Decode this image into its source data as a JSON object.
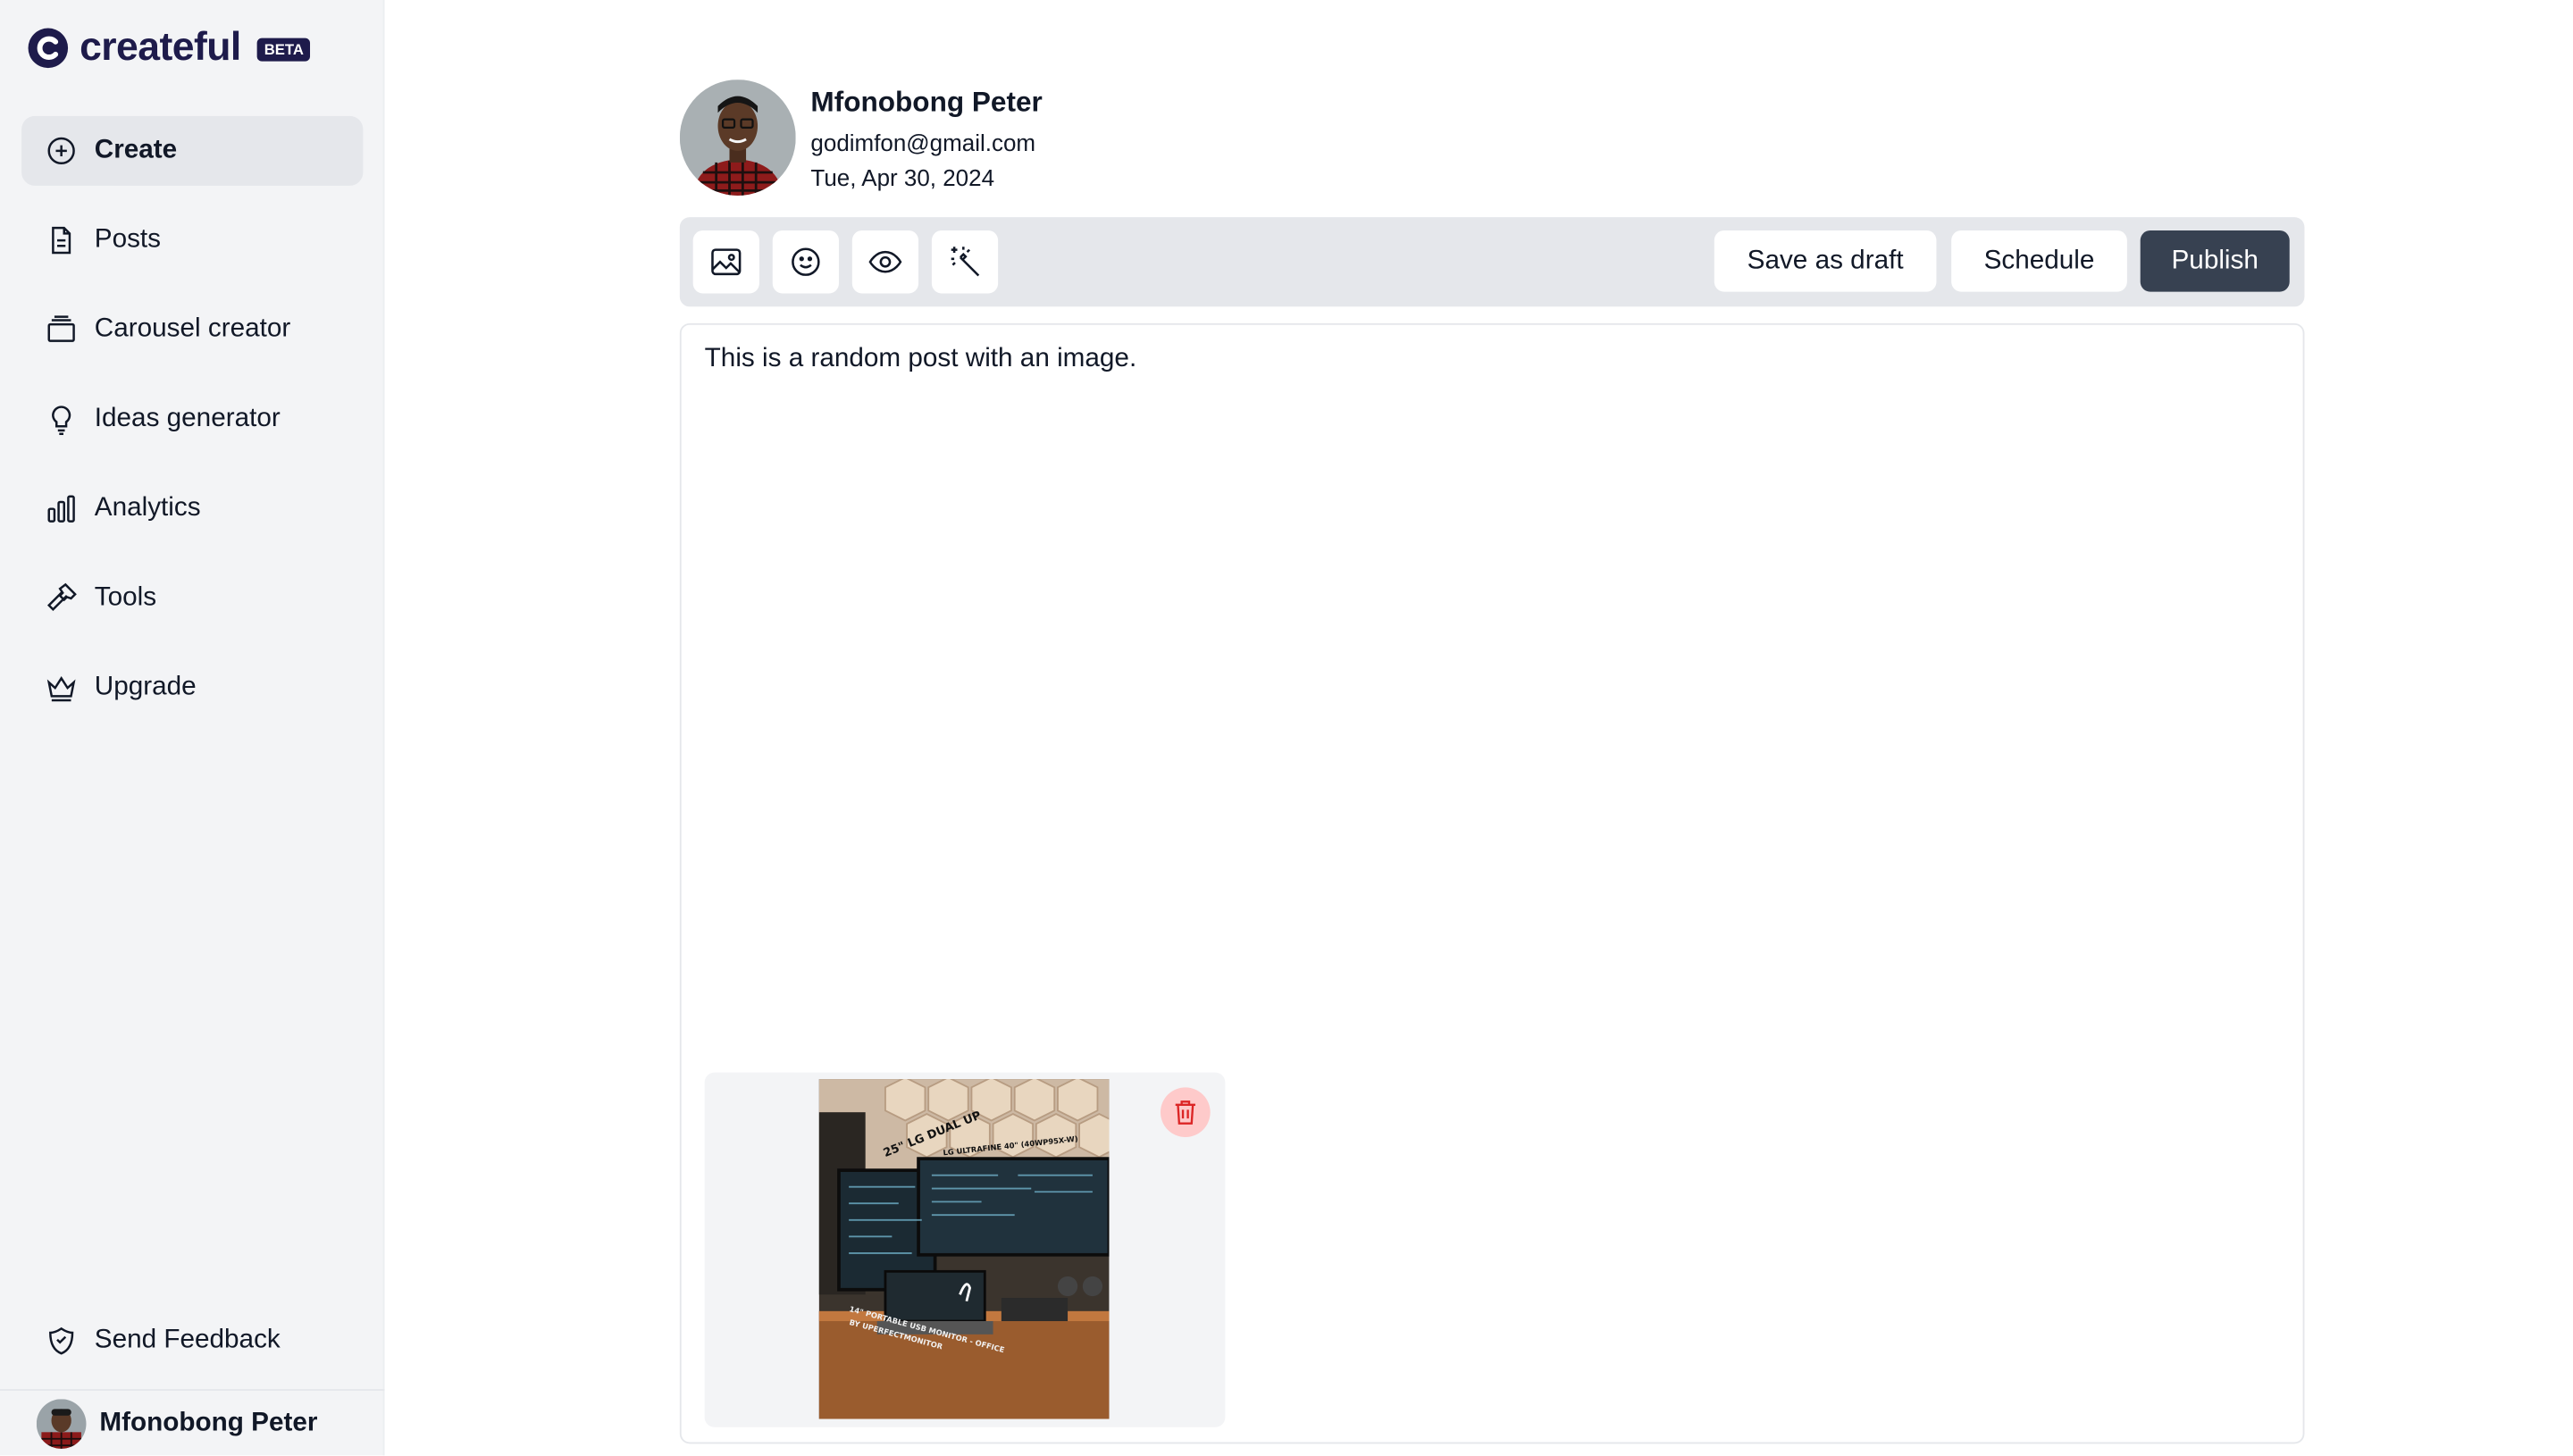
{
  "app": {
    "logo_text": "createful",
    "badge": "BETA",
    "brand_color": "#1e1b4b"
  },
  "sidebar": {
    "items": [
      {
        "label": "Create",
        "icon": "plus-circle-icon",
        "active": true
      },
      {
        "label": "Posts",
        "icon": "document-icon"
      },
      {
        "label": "Carousel creator",
        "icon": "stack-icon"
      },
      {
        "label": "Ideas generator",
        "icon": "lightbulb-icon"
      },
      {
        "label": "Analytics",
        "icon": "bar-chart-icon"
      },
      {
        "label": "Tools",
        "icon": "hammer-icon"
      },
      {
        "label": "Upgrade",
        "icon": "crown-icon"
      }
    ],
    "feedback_label": "Send Feedback",
    "feedback_icon": "feedback-icon",
    "user_name": "Mfonobong Peter"
  },
  "profile": {
    "name": "Mfonobong Peter",
    "email": "godimfon@gmail.com",
    "date": "Tue, Apr 30, 2024"
  },
  "toolbar": {
    "tools": [
      "image-icon",
      "emoji-icon",
      "preview-eye-icon",
      "magic-wand-icon"
    ],
    "save_draft_label": "Save as draft",
    "schedule_label": "Schedule",
    "publish_label": "Publish",
    "publish_color": "#374151"
  },
  "editor": {
    "text": "This is a random post with an image.",
    "image_caption_text_1": "25\" LG DUAL UP",
    "image_caption_text_2": "LG ULTRAFINE 40\" (40WP95X-W)",
    "image_caption_text_3": "14\" PORTABLE USB MONITOR - OFFICE",
    "image_caption_text_4": "BY UPERFECTMONITOR",
    "delete_icon": "trash-icon",
    "delete_color": "#dc2626"
  }
}
